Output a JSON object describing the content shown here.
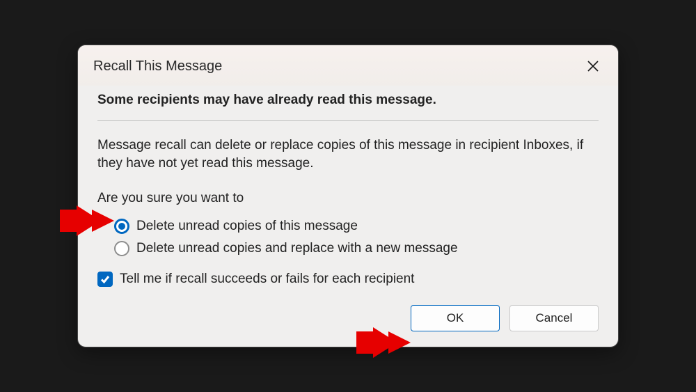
{
  "dialog": {
    "title": "Recall This Message",
    "warning": "Some recipients may have already read this message.",
    "description": "Message recall can delete or replace copies of this message in recipient Inboxes, if they have not yet read this message.",
    "prompt": "Are you sure you want to",
    "options": {
      "delete": "Delete unread copies of this message",
      "replace": "Delete unread copies and replace with a new message",
      "selected": "delete"
    },
    "confirm": {
      "label": "Tell me if recall succeeds or fails for each recipient",
      "checked": true
    },
    "buttons": {
      "ok": "OK",
      "cancel": "Cancel"
    }
  }
}
